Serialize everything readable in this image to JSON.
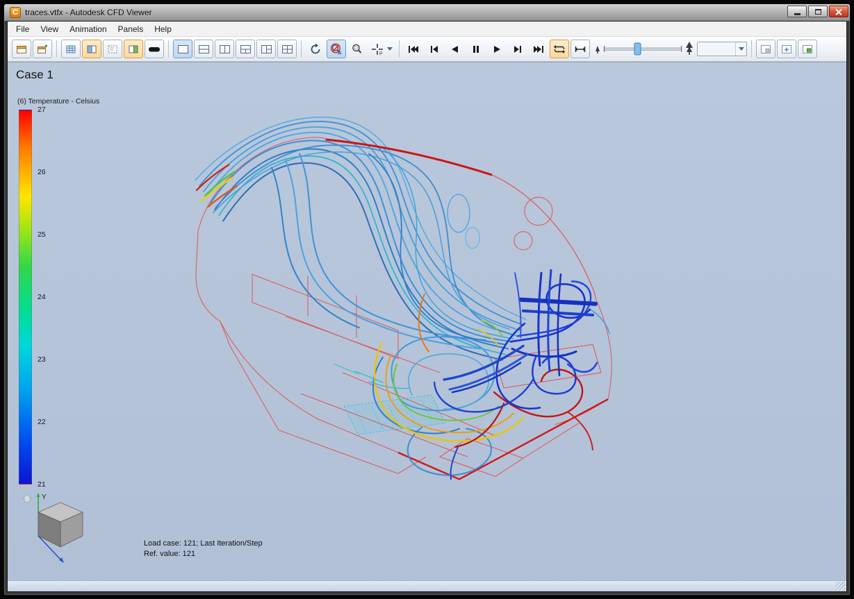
{
  "window": {
    "icon_letter": "C",
    "title": "traces.vtfx - Autodesk CFD Viewer"
  },
  "menu": {
    "items": [
      "File",
      "View",
      "Animation",
      "Panels",
      "Help"
    ]
  },
  "toolbar": {
    "zoom_annotation": "A",
    "probe_annotation": "P",
    "combo_value": "",
    "icon_names": [
      "window-icon",
      "window-new-icon",
      "grid-icon",
      "panel-blue-icon",
      "panel-dashed-icon",
      "panel-green-icon",
      "dark-pill-icon",
      "layout-single-icon",
      "layout-hsplit-icon",
      "layout-vsplit-icon",
      "layout-t-icon",
      "layout-right-split-icon",
      "layout-quad-icon",
      "rotate-icon",
      "zoom-disabled-icon",
      "magnifier-icon",
      "probe-crosshair-icon",
      "skip-start-icon",
      "step-back-icon",
      "play-reverse-icon",
      "pause-icon",
      "play-icon",
      "step-forward-icon",
      "skip-end-icon",
      "loop-icon",
      "bounce-icon",
      "speed-slider",
      "result-combo",
      "overlay-panel-icon",
      "overlay-plus-icon",
      "overlay-green-icon"
    ]
  },
  "viewport": {
    "case_title": "Case 1",
    "status_line1": "Load case: 121; Last Iteration/Step",
    "status_line2": "Ref. value: 121"
  },
  "legend": {
    "title": "(6) Temperature - Celsius",
    "ticks": [
      "27",
      "26",
      "25",
      "24",
      "23",
      "22",
      "21"
    ],
    "colors_top_to_bottom": [
      "#ff0000",
      "#ff7a00",
      "#ffe600",
      "#9fe414",
      "#2fd84a",
      "#00dc9c",
      "#00d8dc",
      "#00a2ee",
      "#0050f0",
      "#0a16d2"
    ]
  },
  "nav_cube": {
    "y_axis_label": "Y"
  }
}
